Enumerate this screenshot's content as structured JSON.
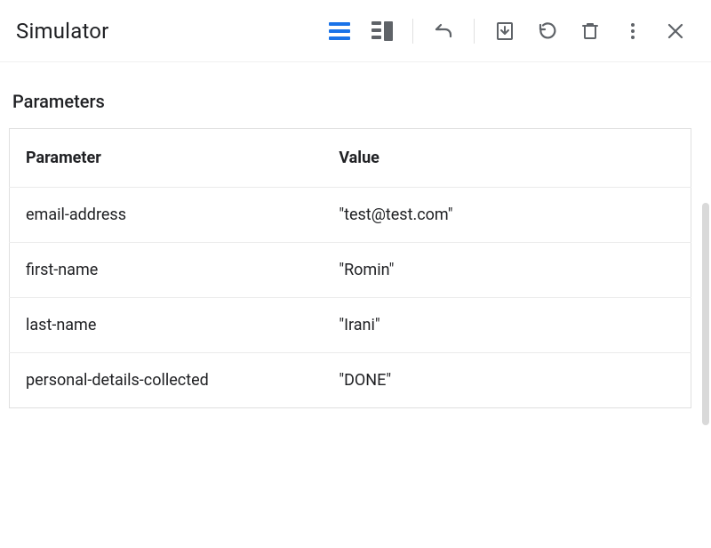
{
  "header": {
    "title": "Simulator"
  },
  "panel": {
    "section_title": "Parameters",
    "columns": {
      "parameter": "Parameter",
      "value": "Value"
    },
    "rows": [
      {
        "parameter": "email-address",
        "value": "\"test@test.com\""
      },
      {
        "parameter": "first-name",
        "value": "\"Romin\""
      },
      {
        "parameter": "last-name",
        "value": "\"Irani\""
      },
      {
        "parameter": "personal-details-collected",
        "value": "\"DONE\""
      }
    ]
  }
}
